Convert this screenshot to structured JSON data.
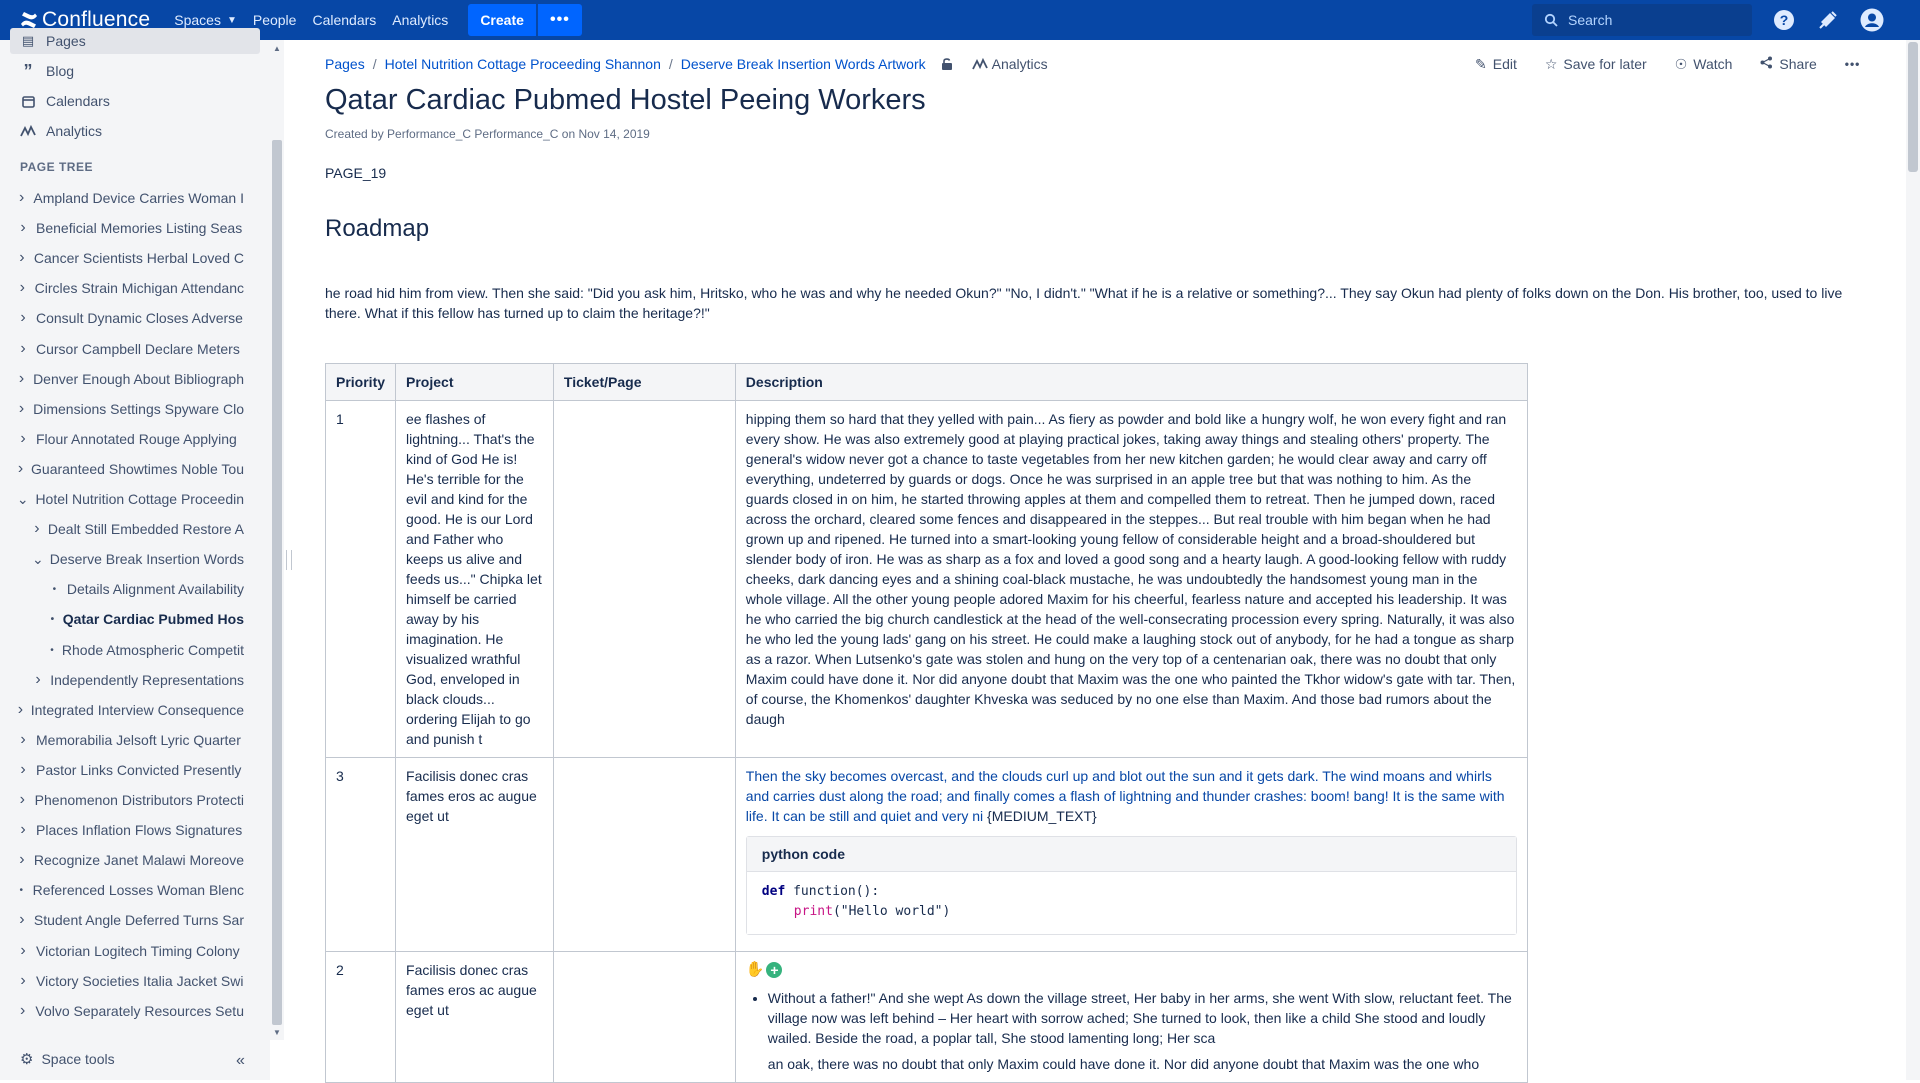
{
  "topnav": {
    "logo_text": "Confluence",
    "spaces": "Spaces",
    "people": "People",
    "calendars": "Calendars",
    "analytics": "Analytics",
    "create": "Create",
    "more": "•••",
    "search_placeholder": "Search"
  },
  "sidebar": {
    "items": [
      {
        "label": "Pages",
        "icon": "pages-icon"
      },
      {
        "label": "Blog",
        "icon": "quote-icon"
      },
      {
        "label": "Calendars",
        "icon": "calendar-icon"
      },
      {
        "label": "Analytics",
        "icon": "analytics-icon"
      }
    ],
    "page_tree_label": "PAGE TREE",
    "tree": [
      {
        "label": "Ampland Device Carries Woman I",
        "level": 0,
        "toggle": "collapsed"
      },
      {
        "label": "Beneficial Memories Listing Seas",
        "level": 0,
        "toggle": "collapsed"
      },
      {
        "label": "Cancer Scientists Herbal Loved C",
        "level": 0,
        "toggle": "collapsed"
      },
      {
        "label": "Circles Strain Michigan Attendanc",
        "level": 0,
        "toggle": "collapsed"
      },
      {
        "label": "Consult Dynamic Closes Adverse",
        "level": 0,
        "toggle": "collapsed"
      },
      {
        "label": "Cursor Campbell Declare Meters",
        "level": 0,
        "toggle": "collapsed"
      },
      {
        "label": "Denver Enough About Bibliograph",
        "level": 0,
        "toggle": "collapsed"
      },
      {
        "label": "Dimensions Settings Spyware Clo",
        "level": 0,
        "toggle": "collapsed"
      },
      {
        "label": "Flour Annotated Rouge Applying",
        "level": 0,
        "toggle": "collapsed"
      },
      {
        "label": "Guaranteed Showtimes Noble Tou",
        "level": 0,
        "toggle": "collapsed"
      },
      {
        "label": "Hotel Nutrition Cottage Proceedin",
        "level": 0,
        "toggle": "expanded"
      },
      {
        "label": "Dealt Still Embedded Restore A",
        "level": 1,
        "toggle": "collapsed"
      },
      {
        "label": "Deserve Break Insertion Words",
        "level": 1,
        "toggle": "expanded"
      },
      {
        "label": "Details Alignment Availability",
        "level": 2,
        "toggle": "leaf"
      },
      {
        "label": "Qatar Cardiac Pubmed Hos",
        "level": 2,
        "toggle": "leaf",
        "current": true
      },
      {
        "label": "Rhode Atmospheric Competit",
        "level": 2,
        "toggle": "leaf"
      },
      {
        "label": "Independently Representations",
        "level": 1,
        "toggle": "collapsed"
      },
      {
        "label": "Integrated Interview Consequence",
        "level": 0,
        "toggle": "collapsed"
      },
      {
        "label": "Memorabilia Jelsoft Lyric Quarter",
        "level": 0,
        "toggle": "collapsed"
      },
      {
        "label": "Pastor Links Convicted Presently",
        "level": 0,
        "toggle": "collapsed"
      },
      {
        "label": "Phenomenon Distributors Protecti",
        "level": 0,
        "toggle": "collapsed"
      },
      {
        "label": "Places Inflation Flows Signatures",
        "level": 0,
        "toggle": "collapsed"
      },
      {
        "label": "Recognize Janet Malawi Moreove",
        "level": 0,
        "toggle": "collapsed"
      },
      {
        "label": "Referenced Losses Woman Blenc",
        "level": 0,
        "toggle": "leaf"
      },
      {
        "label": "Student Angle Deferred Turns Sar",
        "level": 0,
        "toggle": "collapsed"
      },
      {
        "label": "Victorian Logitech Timing Colony",
        "level": 0,
        "toggle": "collapsed"
      },
      {
        "label": "Victory Societies Italia Jacket Swi",
        "level": 0,
        "toggle": "collapsed"
      },
      {
        "label": "Volvo Separately Resources Setu",
        "level": 0,
        "toggle": "collapsed"
      }
    ],
    "space_tools": "Space tools",
    "collapse": "«"
  },
  "breadcrumbs": [
    "Pages",
    "Hotel Nutrition Cottage Proceeding Shannon",
    "Deserve Break Insertion Words Artwork"
  ],
  "analytics_link": "Analytics",
  "actions": {
    "edit": "Edit",
    "save_for_later": "Save for later",
    "watch": "Watch",
    "share": "Share",
    "more": "•••"
  },
  "page": {
    "title": "Qatar Cardiac Pubmed Hostel Peeing Workers",
    "byline": "Created by Performance_C Performance_C on Nov 14, 2019",
    "page_id": "PAGE_19",
    "section_heading": "Roadmap",
    "intro": "he road hid him from view. Then she said: \"Did you ask him, Hritsko, who he was and why he needed Okun?\" \"No, I didn't.\" \"What if he is a relative or something?... They say Okun had plenty of folks down on the Don. His brother, too, used to live there. What if this fellow has turned up to claim the heritage?!\""
  },
  "table": {
    "headers": [
      "Priority",
      "Project",
      "Ticket/Page",
      "Description"
    ],
    "rows": [
      {
        "priority": "1",
        "project": "ee flashes of lightning... That's the kind of God He is! He's terrible for the evil and kind for the good. He is our Lord and Father who keeps us alive and feeds us...\" Chipka let himself be carried away by his imagination. He visualized wrathful God, enveloped in black clouds... ordering Elijah to go and punish t",
        "ticket": "",
        "description": "hipping them so hard that they yelled with pain... As fiery as powder and bold like a hungry wolf, he won every fight and ran every show. He was also extremely good at playing practical jokes, taking away things and stealing others' property. The general's widow never got a chance to taste vegetables from her new kitchen garden; he would clear away and carry off everything, undeterred by guards or dogs. Once he was surprised in an apple tree but that was nothing to him. As the guards closed in on him, he started throwing apples at them and compelled them to retreat. Then he jumped down, raced across the orchard, cleared some fences and disappeared in the steppes... But real trouble with him began when he had grown up and ripened. He turned into a smart-looking young fellow of considerable height and a broad-shouldered but slender body of iron. He was as sharp as a fox and loved a good song and a hearty laugh. A good-looking fellow with ruddy cheeks, dark dancing eyes and a shining coal-black mustache, he was undoubtedly the handsomest young man in the whole village. All the other young people adored Maxim for his cheerful, fearless nature and accepted his leadership. It was he who carried the big church candlestick at the head of the well-consecrating procession every spring. Naturally, it was also he who led the young lads' gang on his street. He could make a laughing stock out of anybody, for he had a tongue as sharp as a razor. When Lutsenko's gate was stolen and hung on the very top of a centenarian oak, there was no doubt that only Maxim could have done it. Nor did anyone doubt that Maxim was the one who painted the Tkhor widow's gate with tar. Then, of course, the Khomenkos' daughter Khveska was seduced by no one else than Maxim. And those bad rumors about the daugh"
      },
      {
        "priority": "3",
        "project": "Facilisis donec cras fames eros ac augue eget ut",
        "ticket": "",
        "description_blue": "Then the sky becomes overcast, and the clouds curl up and blot out the sun and it gets dark. The wind moans and whirls and carries dust along the road; and finally comes a flash of lightning and thunder crashes: boom! bang! It is the same with life. It can be still and quiet and very ni",
        "description_tail": " {MEDIUM_TEXT}",
        "code_title": "python code",
        "code_line1_kw": "def",
        "code_line1_rest": " function():",
        "code_line2_fn": "print",
        "code_line2_str": "(\"Hello world\")"
      },
      {
        "priority": "2",
        "project": "Facilisis donec cras fames eros ac augue eget ut",
        "ticket": "",
        "list_item": "Without a father!\" And she wept As down the village street, Her baby in her arms, she went With slow, reluctant feet. The village now was left behind – Her heart with sorrow ached; She turned to look, then like a child She stood and loudly wailed. Beside the road, a poplar tall, She stood lamenting long; Her sca",
        "continued": "an oak, there was no doubt that only Maxim could have done it. Nor did anyone doubt that Maxim was the one who"
      }
    ]
  }
}
